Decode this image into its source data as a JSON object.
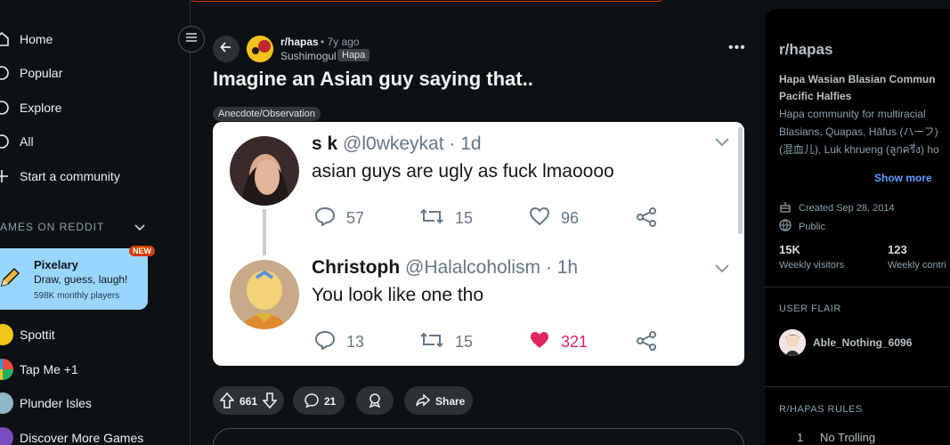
{
  "left_nav": {
    "items": [
      {
        "label": "Home",
        "icon": "home-icon"
      },
      {
        "label": "Popular",
        "icon": "popular-icon"
      },
      {
        "label": "Explore",
        "icon": "explore-icon"
      },
      {
        "label": "All",
        "icon": "all-icon"
      },
      {
        "label": "Start a community",
        "icon": "plus-icon"
      }
    ],
    "games_header": "AMES ON REDDIT",
    "featured_game": {
      "title": "Pixelary",
      "subtitle": "Draw, guess, laugh!",
      "meta": "598K monthly players",
      "badge": "NEW"
    },
    "games": [
      {
        "label": "Spottit"
      },
      {
        "label": "Tap Me +1"
      },
      {
        "label": "Plunder Isles"
      },
      {
        "label": "Discover More Games"
      }
    ]
  },
  "post": {
    "subreddit": "r/hapas",
    "time": "• 7y ago",
    "author": "Sushimogul",
    "user_flair": "Hapa",
    "title": "Imagine an Asian guy saying that..",
    "post_flair": "Anecdote/Observation",
    "tweets": [
      {
        "name": "s k",
        "handle": "@l0wkeykat · 1d",
        "text": "asian guys are ugly as fuck lmaoooo",
        "replies": "57",
        "retweets": "15",
        "likes": "96"
      },
      {
        "name": "Christoph",
        "handle": "@Halalcoholism · 1h",
        "text": "You look like one tho",
        "replies": "13",
        "retweets": "15",
        "likes": "321"
      }
    ],
    "actions": {
      "votes": "661",
      "comments": "21",
      "share": "Share"
    }
  },
  "right_sidebar": {
    "name": "r/hapas",
    "desc_title_1": "Hapa Wasian Blasian Commun",
    "desc_title_2": "Pacific Halfies",
    "desc_1": "Hapa community for multiracial",
    "desc_2": "Blasians, Quapas, Hāfus (ハーフ)",
    "desc_3": "(混血儿), Luk khrueng (ลูกครึ่ง) ho",
    "show_more": "Show more",
    "created": "Created Sep 28, 2014",
    "visibility": "Public",
    "stats": [
      {
        "value": "15K",
        "label": "Weekly visitors"
      },
      {
        "value": "123",
        "label": "Weekly contri"
      }
    ],
    "user_flair_header": "USER FLAIR",
    "user_flair_name": "Able_Nothing_6096",
    "rules_header": "R/HAPAS RULES",
    "rules": [
      {
        "num": "1",
        "text": "No Trolling"
      }
    ]
  },
  "colors": {
    "accent": "#d93a00",
    "link": "#5e9eff",
    "like": "#e0245e",
    "background": "#0e1113"
  }
}
